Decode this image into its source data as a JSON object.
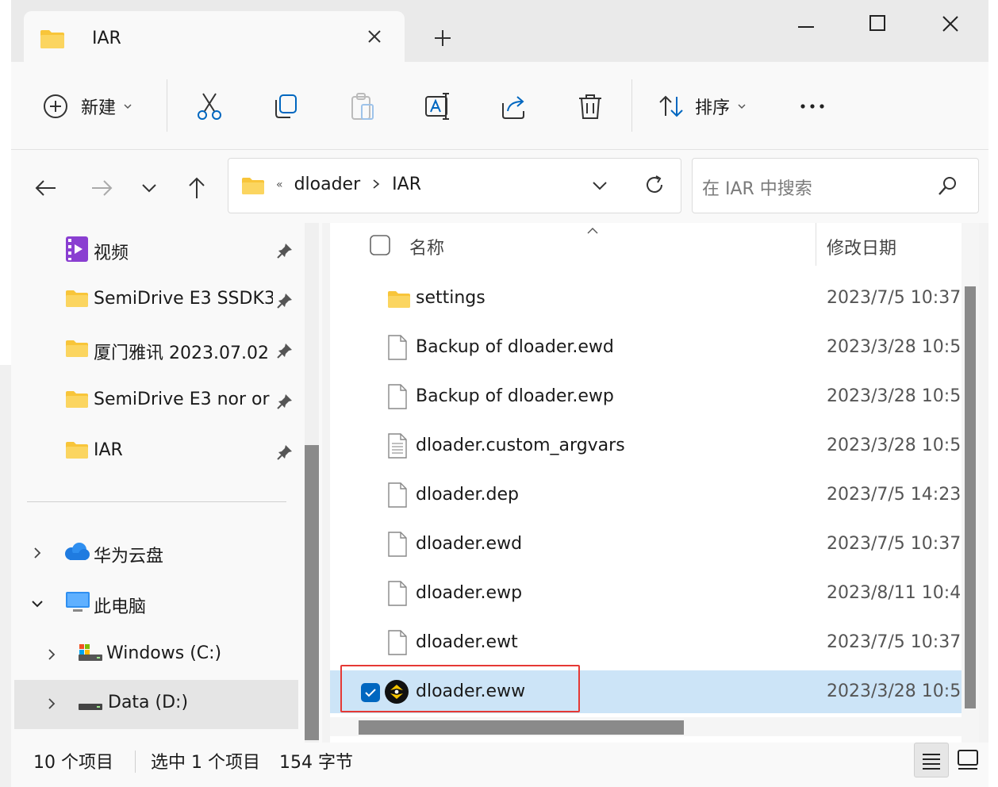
{
  "tab": {
    "title": "IAR"
  },
  "toolbar": {
    "new_label": "新建",
    "sort_label": "排序"
  },
  "address": {
    "overflow": "«",
    "crumbs": [
      "dloader",
      "IAR"
    ]
  },
  "search": {
    "placeholder": "在 IAR 中搜索"
  },
  "sidebar": {
    "quick": [
      {
        "label": "视频",
        "icon": "video-icon"
      },
      {
        "label": "SemiDrive E3 SSDK3",
        "icon": "folder-icon"
      },
      {
        "label": "厦门雅讯 2023.07.02",
        "icon": "folder-icon"
      },
      {
        "label": "SemiDrive E3 nor or",
        "icon": "folder-icon"
      },
      {
        "label": "IAR",
        "icon": "folder-icon"
      }
    ],
    "tree": [
      {
        "label": "华为云盘",
        "icon": "cloud-icon"
      },
      {
        "label": "此电脑",
        "icon": "computer-icon"
      },
      {
        "label": "Windows (C:)",
        "icon": "drive-icon"
      },
      {
        "label": "Data (D:)",
        "icon": "drive-icon"
      }
    ]
  },
  "list": {
    "col_name": "名称",
    "col_date": "修改日期",
    "rows": [
      {
        "name": "settings",
        "date": "2023/7/5 10:37",
        "type": "folder"
      },
      {
        "name": "Backup of dloader.ewd",
        "date": "2023/3/28 10:5",
        "type": "file"
      },
      {
        "name": "Backup of dloader.ewp",
        "date": "2023/3/28 10:5",
        "type": "file"
      },
      {
        "name": "dloader.custom_argvars",
        "date": "2023/3/28 10:5",
        "type": "text"
      },
      {
        "name": "dloader.dep",
        "date": "2023/7/5 14:23",
        "type": "file"
      },
      {
        "name": "dloader.ewd",
        "date": "2023/7/5 10:37",
        "type": "file"
      },
      {
        "name": "dloader.ewp",
        "date": "2023/8/11 10:4",
        "type": "file"
      },
      {
        "name": "dloader.ewt",
        "date": "2023/7/5 10:37",
        "type": "file"
      },
      {
        "name": "dloader.eww",
        "date": "2023/3/28 10:5",
        "type": "iar"
      }
    ]
  },
  "status": {
    "count": "10 个项目",
    "selected": "选中 1 个项目",
    "size": "154 字节"
  },
  "colors": {
    "accent": "#0067c0",
    "selection": "#cce4f7",
    "folder": "#f8c53a",
    "highlight_box": "#e53935"
  }
}
